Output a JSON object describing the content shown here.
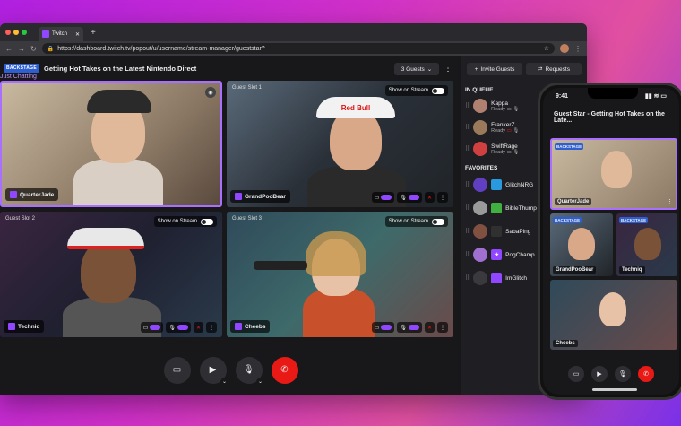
{
  "browser": {
    "tab_title": "Twitch",
    "url": "https://dashboard.twitch.tv/popout/u/username/stream-manager/gueststar?"
  },
  "header": {
    "badge": "BACKSTAGE",
    "title": "Getting Hot Takes on the Latest Nintendo Direct",
    "category": "Just Chatting",
    "guests_label": "3 Guests"
  },
  "slots": [
    {
      "label": "",
      "name": "QuarterJade"
    },
    {
      "label": "Guest Slot 1",
      "name": "GrandPooBear",
      "show_label": "Show on Stream"
    },
    {
      "label": "Guest Slot 2",
      "name": "Techniq",
      "show_label": "Show on Stream"
    },
    {
      "label": "Guest Slot 3",
      "name": "Cheebs",
      "show_label": "Show on Stream"
    }
  ],
  "sidebar": {
    "invite_label": "Invite Guests",
    "requests_label": "Requests",
    "in_queue_title": "IN QUEUE",
    "queue": [
      {
        "name": "Kappa",
        "status": "Ready"
      },
      {
        "name": "FrankerZ",
        "status": "Ready"
      },
      {
        "name": "SwiftRage",
        "status": "Ready"
      }
    ],
    "favorites_title": "FAVORITES",
    "favorites": [
      {
        "name": "GlitchNRG"
      },
      {
        "name": "BibleThump"
      },
      {
        "name": "SabaPing"
      },
      {
        "name": "PogChamp"
      },
      {
        "name": "ImGlitch"
      }
    ]
  },
  "phone": {
    "time": "9:41",
    "title": "Guest Star - Getting Hot Takes on the Late...",
    "badge": "BACKSTAGE",
    "names": [
      "QuarterJade",
      "GrandPooBear",
      "Techniq",
      "Cheebs"
    ]
  },
  "colors": {
    "accent": "#9146ff",
    "badge": "#2e5fd0",
    "end_call": "#e91916"
  }
}
